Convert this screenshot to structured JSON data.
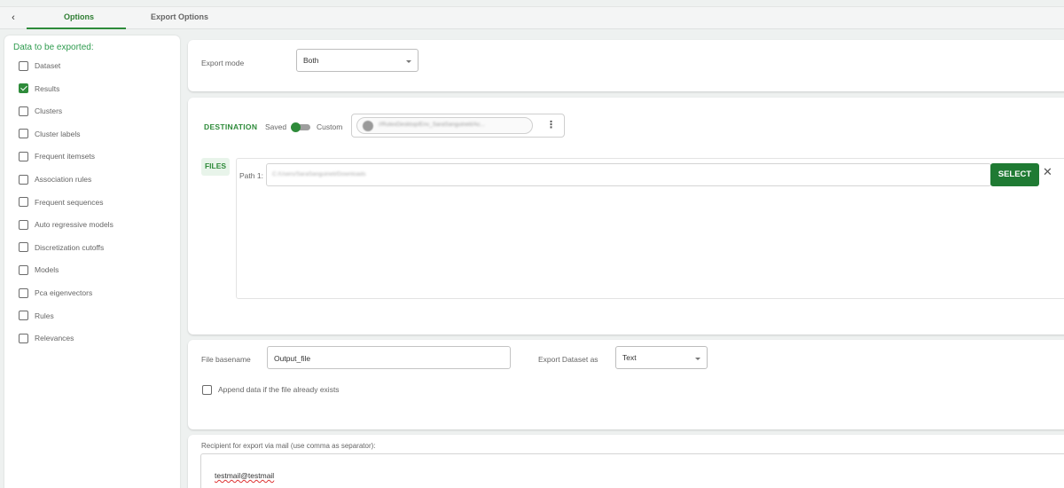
{
  "tabs": {
    "back_icon": "chevron-left-icon",
    "back_glyph": "‹",
    "items": [
      {
        "label": "Options",
        "active": true
      },
      {
        "label": "Export Options",
        "active": false
      }
    ]
  },
  "colors": {
    "accent": "#2e8b3a",
    "button": "#1f7a33",
    "background": "#eef1f0"
  },
  "sidebar": {
    "title": "Data to be exported:",
    "items": [
      {
        "label": "Dataset",
        "checked": false
      },
      {
        "label": "Results",
        "checked": true
      },
      {
        "label": "Clusters",
        "checked": false
      },
      {
        "label": "Cluster labels",
        "checked": false
      },
      {
        "label": "Frequent itemsets",
        "checked": false
      },
      {
        "label": "Association rules",
        "checked": false
      },
      {
        "label": "Frequent sequences",
        "checked": false
      },
      {
        "label": "Auto regressive models",
        "checked": false
      },
      {
        "label": "Discretization cutoffs",
        "checked": false
      },
      {
        "label": "Models",
        "checked": false
      },
      {
        "label": "Pca eigenvectors",
        "checked": false
      },
      {
        "label": "Rules",
        "checked": false
      },
      {
        "label": "Relevances",
        "checked": false
      }
    ]
  },
  "export_mode": {
    "label": "Export mode",
    "value": "Both"
  },
  "destination": {
    "title": "DESTINATION",
    "saved_label": "Saved",
    "custom_label": "Custom",
    "toggle_on": true,
    "saved_path": "//RulexDesktop/Env_SaraSanguineti/Ac...",
    "menu_glyph": "⋮"
  },
  "files": {
    "title": "FILES",
    "path_label": "Path 1:",
    "path_value": "C:/Users/SaraSanguineti/Downloads",
    "select_label": "SELECT",
    "close_glyph": "✕"
  },
  "output": {
    "basename_label": "File basename",
    "basename_value": "Output_file",
    "dataset_as_label": "Export Dataset as",
    "dataset_as_value": "Text",
    "append_label": "Append data if the file already exists",
    "append_checked": false
  },
  "mail": {
    "label": "Recipient for export via mail (use comma as separator):",
    "value": "testmail@testmail"
  }
}
